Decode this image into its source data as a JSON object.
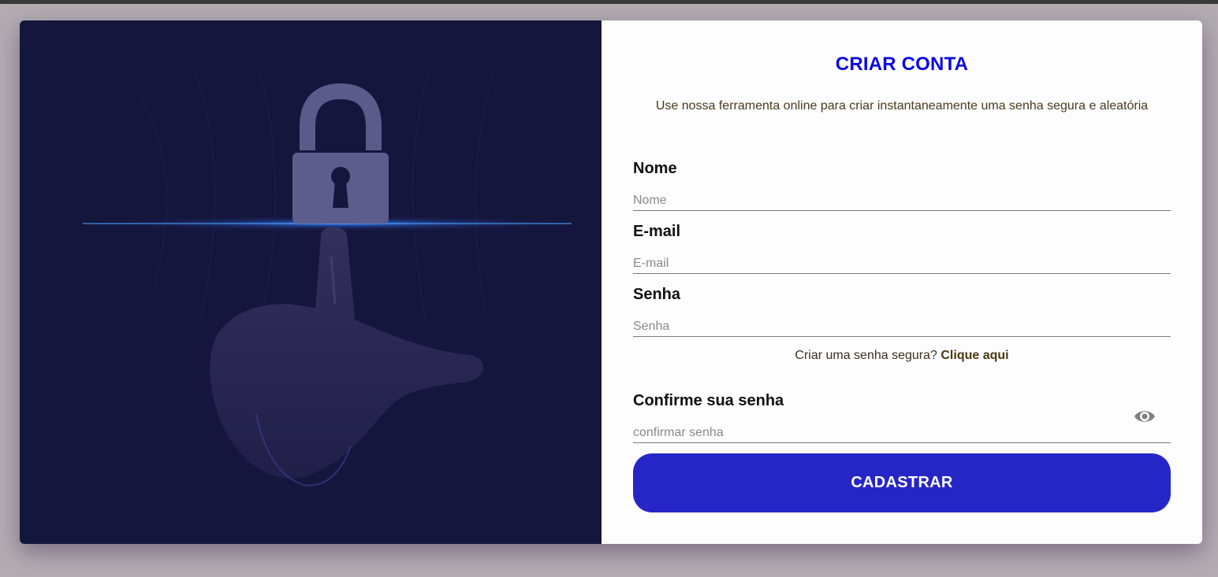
{
  "form": {
    "title": "CRIAR CONTA",
    "subtitle": "Use nossa ferramenta online para criar instantaneamente uma senha segura e aleatória",
    "fields": [
      {
        "label": "Nome",
        "placeholder": "Nome",
        "value": ""
      },
      {
        "label": "E-mail",
        "placeholder": "E-mail",
        "value": ""
      },
      {
        "label": "Senha",
        "placeholder": "Senha",
        "value": ""
      },
      {
        "label": "Confirme sua senha",
        "placeholder": "confirmar senha",
        "value": ""
      }
    ],
    "hint_text": "Criar uma senha segura?",
    "hint_link": "Clique aqui",
    "submit_label": "CADASTRAR"
  },
  "icons": {
    "password_toggle": "eye-icon",
    "hero_image": "padlock-finger-illustration"
  },
  "colors": {
    "title": "#0a06e8",
    "button": "#2626c6",
    "hero_bg": "#14163d",
    "page_bg": "#b3adb3"
  }
}
